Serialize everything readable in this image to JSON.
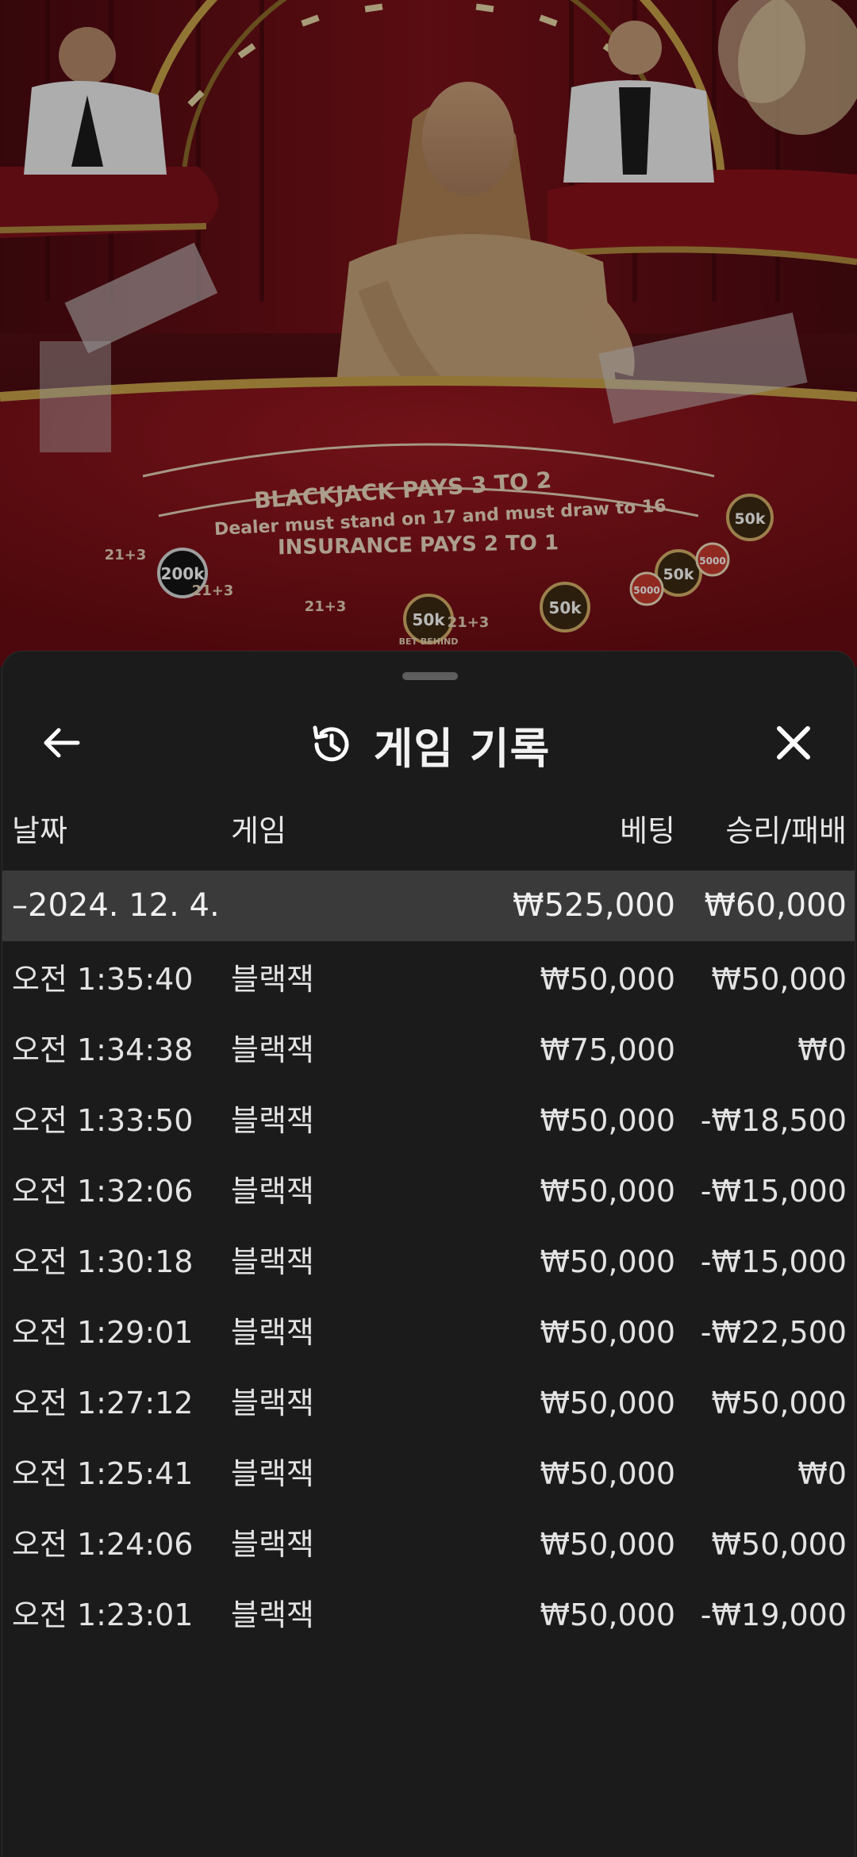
{
  "background": {
    "table_print": {
      "line1": "BLACKJACK PAYS 3 TO 2",
      "line2": "Dealer must stand on 17 and must draw to 16",
      "line3": "INSURANCE PAYS 2 TO 1"
    },
    "chips": [
      "200k",
      "50k",
      "50k",
      "50k",
      "50k",
      "5000",
      "5000"
    ],
    "seat_labels": [
      "21+3",
      "21+3",
      "21+3",
      "21+3"
    ],
    "bet_behind": "BET BEHIND"
  },
  "sheet": {
    "title": "게임 기록",
    "back_icon": "arrow-left-icon",
    "history_icon": "history-clock-icon",
    "close_icon": "close-x-icon"
  },
  "table": {
    "headers": {
      "date": "날짜",
      "game": "게임",
      "bet": "베팅",
      "result": "승리/패배"
    },
    "group": {
      "date": "–2024. 12. 4.",
      "bet": "₩525,000",
      "result": "₩60,000"
    },
    "rows": [
      {
        "time": "오전 1:35:40",
        "game": "블랙잭",
        "bet": "₩50,000",
        "result": "₩50,000"
      },
      {
        "time": "오전 1:34:38",
        "game": "블랙잭",
        "bet": "₩75,000",
        "result": "₩0"
      },
      {
        "time": "오전 1:33:50",
        "game": "블랙잭",
        "bet": "₩50,000",
        "result": "-₩18,500"
      },
      {
        "time": "오전 1:32:06",
        "game": "블랙잭",
        "bet": "₩50,000",
        "result": "-₩15,000"
      },
      {
        "time": "오전 1:30:18",
        "game": "블랙잭",
        "bet": "₩50,000",
        "result": "-₩15,000"
      },
      {
        "time": "오전 1:29:01",
        "game": "블랙잭",
        "bet": "₩50,000",
        "result": "-₩22,500"
      },
      {
        "time": "오전 1:27:12",
        "game": "블랙잭",
        "bet": "₩50,000",
        "result": "₩50,000"
      },
      {
        "time": "오전 1:25:41",
        "game": "블랙잭",
        "bet": "₩50,000",
        "result": "₩0"
      },
      {
        "time": "오전 1:24:06",
        "game": "블랙잭",
        "bet": "₩50,000",
        "result": "₩50,000"
      },
      {
        "time": "오전 1:23:01",
        "game": "블랙잭",
        "bet": "₩50,000",
        "result": "-₩19,000"
      }
    ]
  }
}
